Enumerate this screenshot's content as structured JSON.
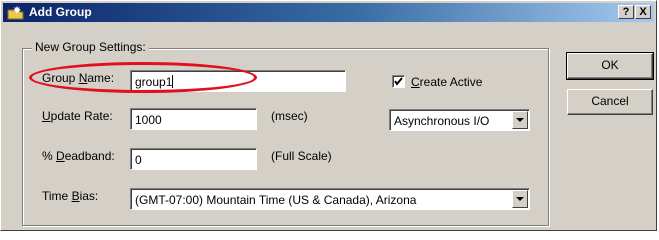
{
  "window": {
    "title": "Add Group",
    "help_label": "?",
    "close_label": "X"
  },
  "group_box": {
    "legend": "New Group Settings:"
  },
  "group_name": {
    "label_pre": "Group ",
    "label_accel": "N",
    "label_post": "ame:",
    "value": "group1"
  },
  "create_active": {
    "label_accel": "C",
    "label_post": "reate Active",
    "checked": true,
    "check_mark": "✓"
  },
  "update_rate": {
    "label_accel": "U",
    "label_post": "pdate Rate:",
    "value": "1000",
    "unit": "(msec)"
  },
  "io_mode": {
    "selected": "Asynchronous I/O"
  },
  "deadband": {
    "label_pre": "% ",
    "label_accel": "D",
    "label_post": "eadband:",
    "value": "0",
    "unit": "(Full Scale)"
  },
  "time_bias": {
    "label_pre": "Time ",
    "label_accel": "B",
    "label_post": "ias:",
    "selected": "(GMT-07:00) Mountain Time (US & Canada), Arizona"
  },
  "buttons": {
    "ok": "OK",
    "cancel": "Cancel"
  },
  "annotation_color": "#e0101e"
}
